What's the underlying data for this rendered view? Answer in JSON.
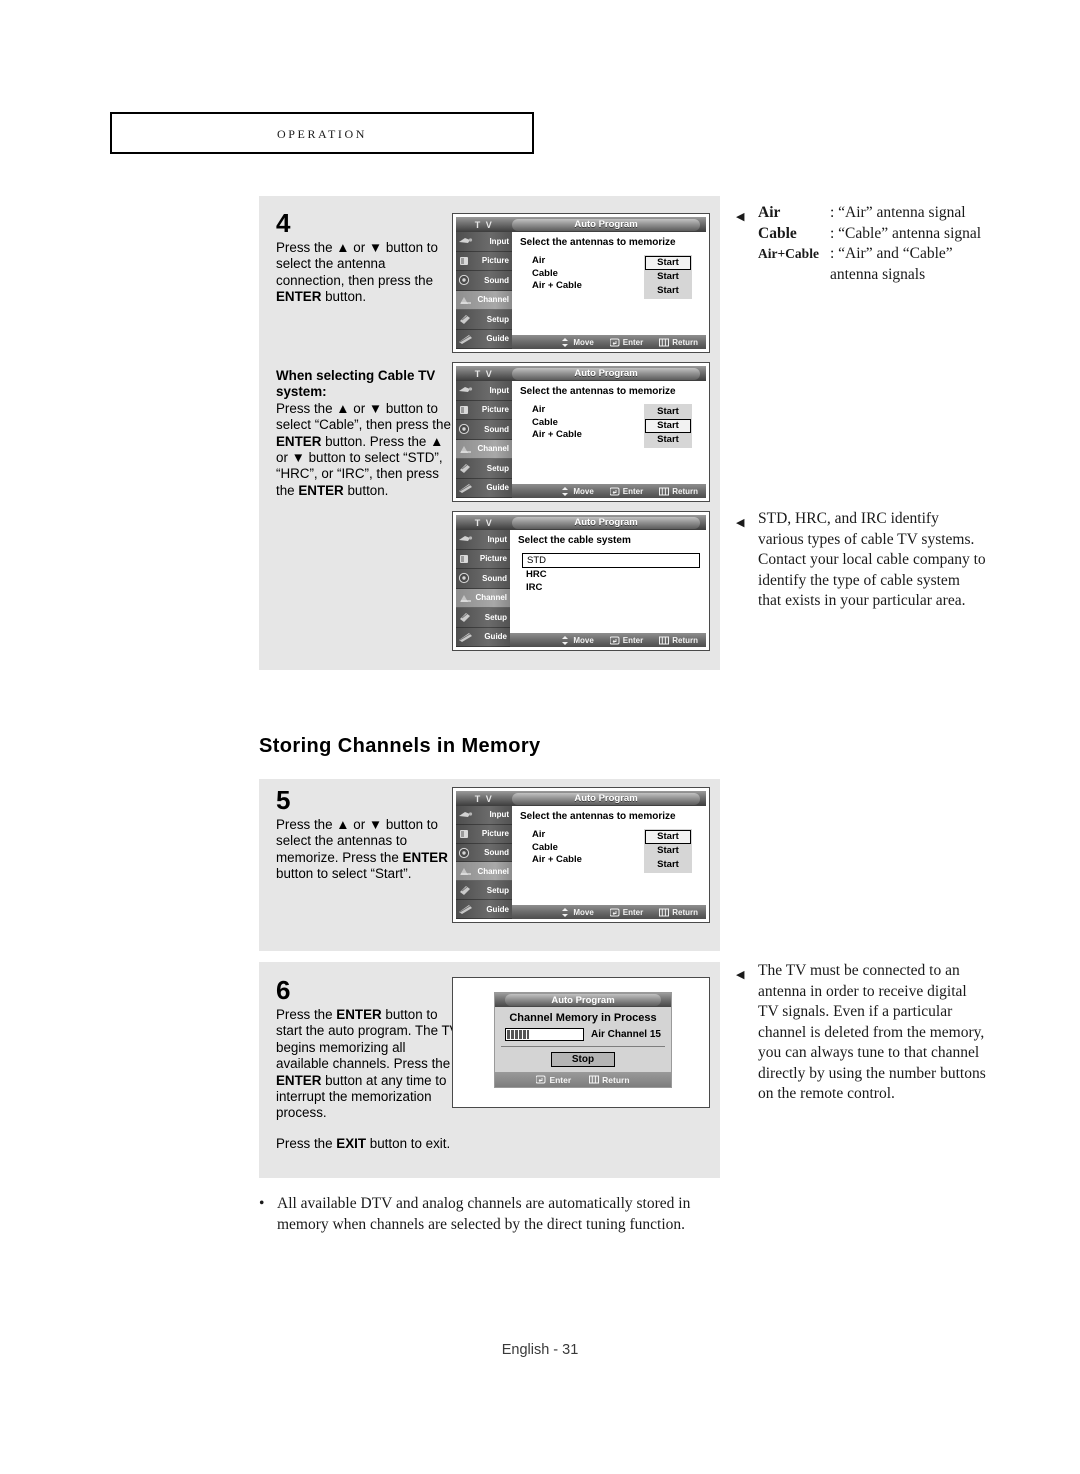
{
  "header": {
    "chapter": "Operation"
  },
  "steps": {
    "step4": {
      "number": "4",
      "line1": "Press the ▲ or ▼ button to select the antenna connection, then press the ",
      "bold1": "ENTER",
      "line2": " button."
    },
    "step4b": {
      "subhead": "When selecting Cable TV system:",
      "line1": "Press the ▲ or ▼ button to select “Cable”, then press the ",
      "bold1": "ENTER",
      "line2": " button. Press the ▲ or ▼ button to select “STD”, “HRC”, or “IRC”, then press the ",
      "bold2": "ENTER",
      "line3": " button."
    },
    "step5": {
      "number": "5",
      "line1": "Press the ▲ or ▼ button to select the antennas to memorize. Press the ",
      "bold1": "ENTER",
      "line2": " button to select “Start”."
    },
    "step6": {
      "number": "6",
      "line1": "Press the ",
      "bold1": "ENTER",
      "line2": " button to start the auto program. The TV begins memorizing all available channels. Press the ",
      "bold2": "ENTER",
      "line3": " button at any time to interrupt the memorization process.",
      "exit_pre": "Press the ",
      "exit_bold": "EXIT",
      "exit_post": " button to exit."
    }
  },
  "section_heading": "Storing Channels in Memory",
  "tv_menu": {
    "logo": "T V",
    "title": "Auto Program",
    "sidebar": [
      {
        "label": "Input",
        "icon": "input-icon"
      },
      {
        "label": "Picture",
        "icon": "picture-icon"
      },
      {
        "label": "Sound",
        "icon": "sound-icon"
      },
      {
        "label": "Channel",
        "icon": "channel-icon"
      },
      {
        "label": "Setup",
        "icon": "setup-icon"
      },
      {
        "label": "Guide",
        "icon": "guide-icon"
      }
    ],
    "selected_sidebar": "Channel",
    "heading_antenna": "Select the antennas to memorize",
    "heading_cable": "Select the cable system",
    "antenna_options": [
      "Air",
      "Cable",
      "Air + Cable"
    ],
    "start_label": "Start",
    "cable_systems": [
      "STD",
      "HRC",
      "IRC"
    ],
    "cable_selected": "STD",
    "footer_move": "Move",
    "footer_enter": "Enter",
    "footer_return": "Return"
  },
  "screens": {
    "tv1_selected_start_index": 0,
    "tv2_selected_start_index": 1,
    "tv5_selected_start_index": 0
  },
  "progress_dialog": {
    "title": "Auto Program",
    "heading": "Channel Memory in Process",
    "channel_label": "Air Channel 15",
    "progress_percent": 28,
    "stop_label": "Stop",
    "footer_enter": "Enter",
    "footer_return": "Return"
  },
  "notes": {
    "antenna": {
      "flag": "◀",
      "rows": [
        {
          "term": "Air",
          "desc": ": “Air” antenna signal"
        },
        {
          "term": "Cable",
          "desc": ": “Cable” antenna signal"
        },
        {
          "term": "Air+Cable",
          "desc": ": “Air” and “Cable” antenna signals"
        }
      ]
    },
    "std": {
      "flag": "◀",
      "text": "STD, HRC, and IRC identify various types of cable TV systems. Contact your local cable company to identify the type of cable system that exists in your particular area."
    },
    "tvmust": {
      "flag": "◀",
      "text": "The TV must be connected to an antenna in order to receive digital TV signals. Even if a particular channel is deleted from the memory, you can always tune to that channel directly by using the number buttons on the remote control."
    }
  },
  "bullet": {
    "dot": "•",
    "text": "All available DTV and analog channels are automatically stored in memory when channels are selected by the direct tuning function."
  },
  "footer": {
    "page": "English - 31"
  }
}
